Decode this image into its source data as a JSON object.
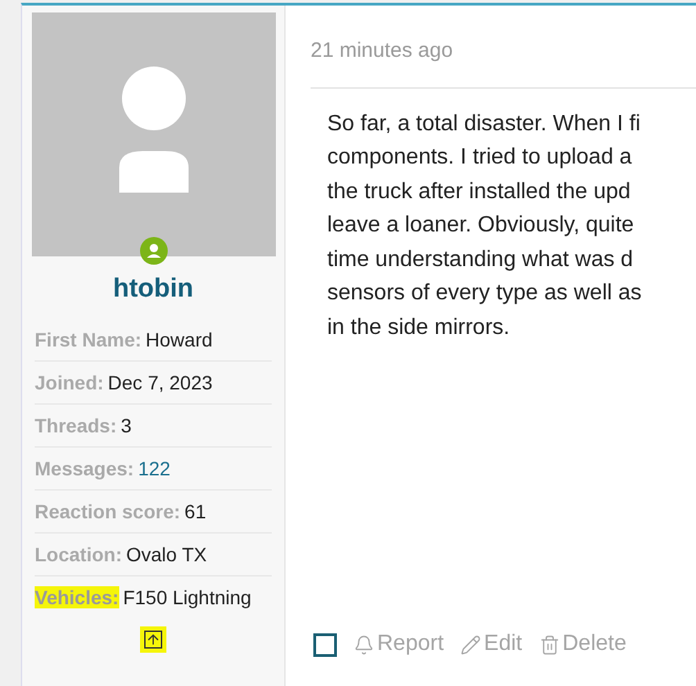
{
  "user": {
    "username": "htobin",
    "online": true,
    "fields": [
      {
        "label": "First Name:",
        "value": "Howard",
        "highlighted": false,
        "link": false
      },
      {
        "label": "Joined:",
        "value": "Dec 7, 2023",
        "highlighted": false,
        "link": false
      },
      {
        "label": "Threads:",
        "value": "3",
        "highlighted": false,
        "link": false
      },
      {
        "label": "Messages:",
        "value": "122",
        "highlighted": false,
        "link": true
      },
      {
        "label": "Reaction score:",
        "value": "61",
        "highlighted": false,
        "link": false
      },
      {
        "label": "Location:",
        "value": "Ovalo TX",
        "highlighted": false,
        "link": false
      },
      {
        "label": "Vehicles:",
        "value": "F150 Lightning",
        "highlighted": true,
        "link": false
      }
    ],
    "expand_highlighted": true
  },
  "post": {
    "time": "21 minutes ago",
    "lines": [
      "So far, a total disaster. When I fi",
      "components. I tried to upload a",
      "the truck after installed the upd",
      "leave a loaner. Obviously, quite",
      "time understanding what was d",
      "sensors of every type as well as",
      "in the side mirrors."
    ],
    "select_checked": false,
    "actions": [
      {
        "kind": "report",
        "label": "Report"
      },
      {
        "kind": "edit",
        "label": "Edit"
      },
      {
        "kind": "delete",
        "label": "Delete"
      }
    ]
  }
}
